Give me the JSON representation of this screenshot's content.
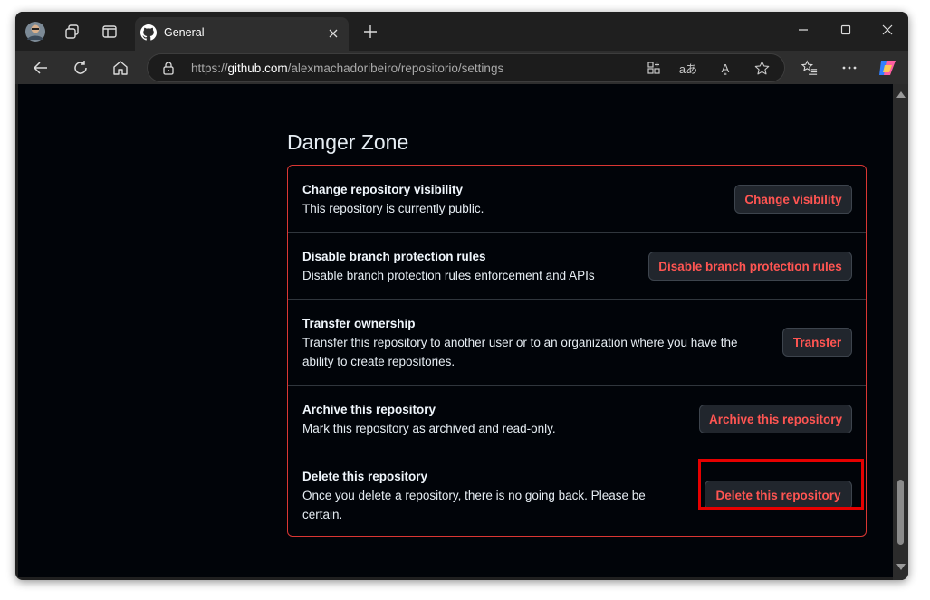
{
  "browser": {
    "tab": {
      "title": "General"
    },
    "address_bar": {
      "url_prefix": "https://",
      "url_host": "github.com",
      "url_path": "/alexmachadoribeiro/repositorio/settings"
    },
    "icons": {
      "read_aloud": "A͈",
      "translate": "aあ"
    }
  },
  "danger_zone": {
    "title": "Danger Zone",
    "accent_color": "#da3633",
    "items": [
      {
        "heading": "Change repository visibility",
        "description": "This repository is currently public.",
        "button": "Change visibility"
      },
      {
        "heading": "Disable branch protection rules",
        "description": "Disable branch protection rules enforcement and APIs",
        "button": "Disable branch protection rules"
      },
      {
        "heading": "Transfer ownership",
        "description": "Transfer this repository to another user or to an organization where you have the ability to create repositories.",
        "button": "Transfer"
      },
      {
        "heading": "Archive this repository",
        "description": "Mark this repository as archived and read-only.",
        "button": "Archive this repository"
      },
      {
        "heading": "Delete this repository",
        "description": "Once you delete a repository, there is no going back. Please be certain.",
        "button": "Delete this repository"
      }
    ]
  }
}
